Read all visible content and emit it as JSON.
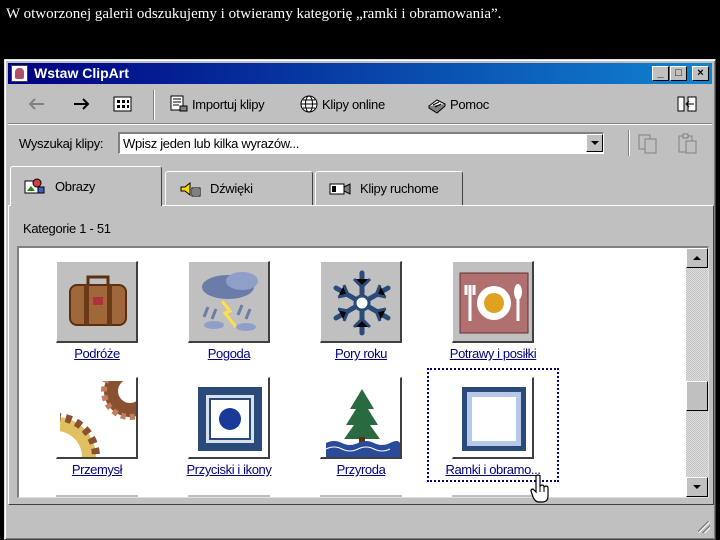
{
  "caption": "W otworzonej galerii odszukujemy i otwieramy kategorię  „ramki i obramowania”.",
  "window": {
    "title": "Wstaw ClipArt",
    "minimize": "_",
    "maximize": "□",
    "close": "×"
  },
  "toolbar": {
    "back_icon": "back-arrow-icon",
    "forward_icon": "forward-arrow-icon",
    "view_icon": "view-grid-icon",
    "import_label": "Importuj klipy",
    "online_label": "Klipy online",
    "help_label": "Pomoc",
    "pane_icon": "change-pane-icon"
  },
  "search": {
    "label": "Wyszukaj klipy:",
    "value": "Wpisz jeden lub kilka wyrazów..."
  },
  "tabs": [
    {
      "label": "Obrazy",
      "icon": "pictures-icon",
      "active": true
    },
    {
      "label": "Dźwięki",
      "icon": "sounds-icon",
      "active": false
    },
    {
      "label": "Klipy ruchome",
      "icon": "motion-clips-icon",
      "active": false
    }
  ],
  "categories_label": "Kategorie 1 - 51",
  "categories": [
    {
      "label": "Podróże",
      "icon": "suitcase-icon"
    },
    {
      "label": "Pogoda",
      "icon": "storm-cloud-icon"
    },
    {
      "label": "Pory roku",
      "icon": "snowflake-icon"
    },
    {
      "label": "Potrawy i posiłki",
      "icon": "plate-cutlery-icon"
    },
    {
      "label": "Przemysł",
      "icon": "gears-icon"
    },
    {
      "label": "Przyciski i ikony",
      "icon": "button-icon"
    },
    {
      "label": "Przyroda",
      "icon": "tree-water-icon"
    },
    {
      "label": "Ramki i obramo...",
      "icon": "frame-icon",
      "selected": true
    }
  ],
  "colors": {
    "titlebar_start": "#000080",
    "titlebar_end": "#1084d0",
    "link": "#000080",
    "face": "#c0c0c0"
  }
}
